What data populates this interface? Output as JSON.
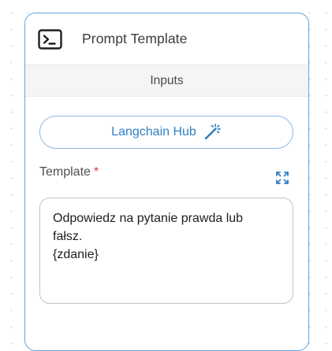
{
  "node": {
    "title": "Prompt Template",
    "icon": "terminal-icon",
    "accent_border": "#5aa6e6"
  },
  "inputs_section": {
    "label": "Inputs"
  },
  "langchain_hub_button": {
    "label": "Langchain Hub",
    "icon": "magic-wand-icon",
    "color": "#2f80c6"
  },
  "template_field": {
    "label": "Template",
    "required_marker": "*",
    "required_color": "#e53935",
    "expand_icon": "expand-icon",
    "value": "Odpowiedz na pytanie prawda lub\nfałsz.\n{zdanie}"
  }
}
